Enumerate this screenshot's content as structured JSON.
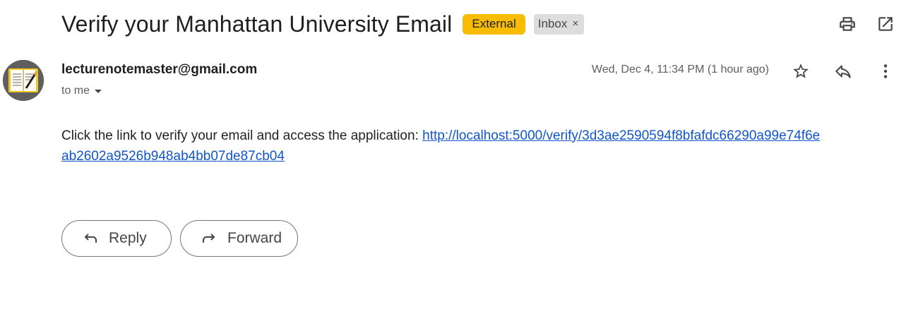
{
  "email": {
    "subject": "Verify your Manhattan University Email",
    "labels": {
      "external": "External",
      "inbox": "Inbox",
      "remove_symbol": "×"
    },
    "sender": "lecturenotemaster@gmail.com",
    "recipient": "to me",
    "timestamp": "Wed, Dec 4, 11:34 PM (1 hour ago)",
    "body": {
      "text": "Click the link to verify your email and access the application: ",
      "link": "http://localhost:5000/verify/3d3ae2590594f8bfafdc66290a99e74f6eab2602a9526b948ab4bb07de87cb04"
    }
  },
  "toolbar": {
    "print_icon": "print-icon",
    "open_new_window_icon": "open-in-new-window-icon"
  },
  "message_actions": {
    "star_icon": "star-icon",
    "reply_icon": "reply-icon",
    "more_icon": "more-vert-icon"
  },
  "buttons": {
    "reply_label": "Reply",
    "forward_label": "Forward"
  },
  "colors": {
    "external_label": "#f9bc05",
    "inbox_label": "#dddddd",
    "link": "#1155cc"
  }
}
